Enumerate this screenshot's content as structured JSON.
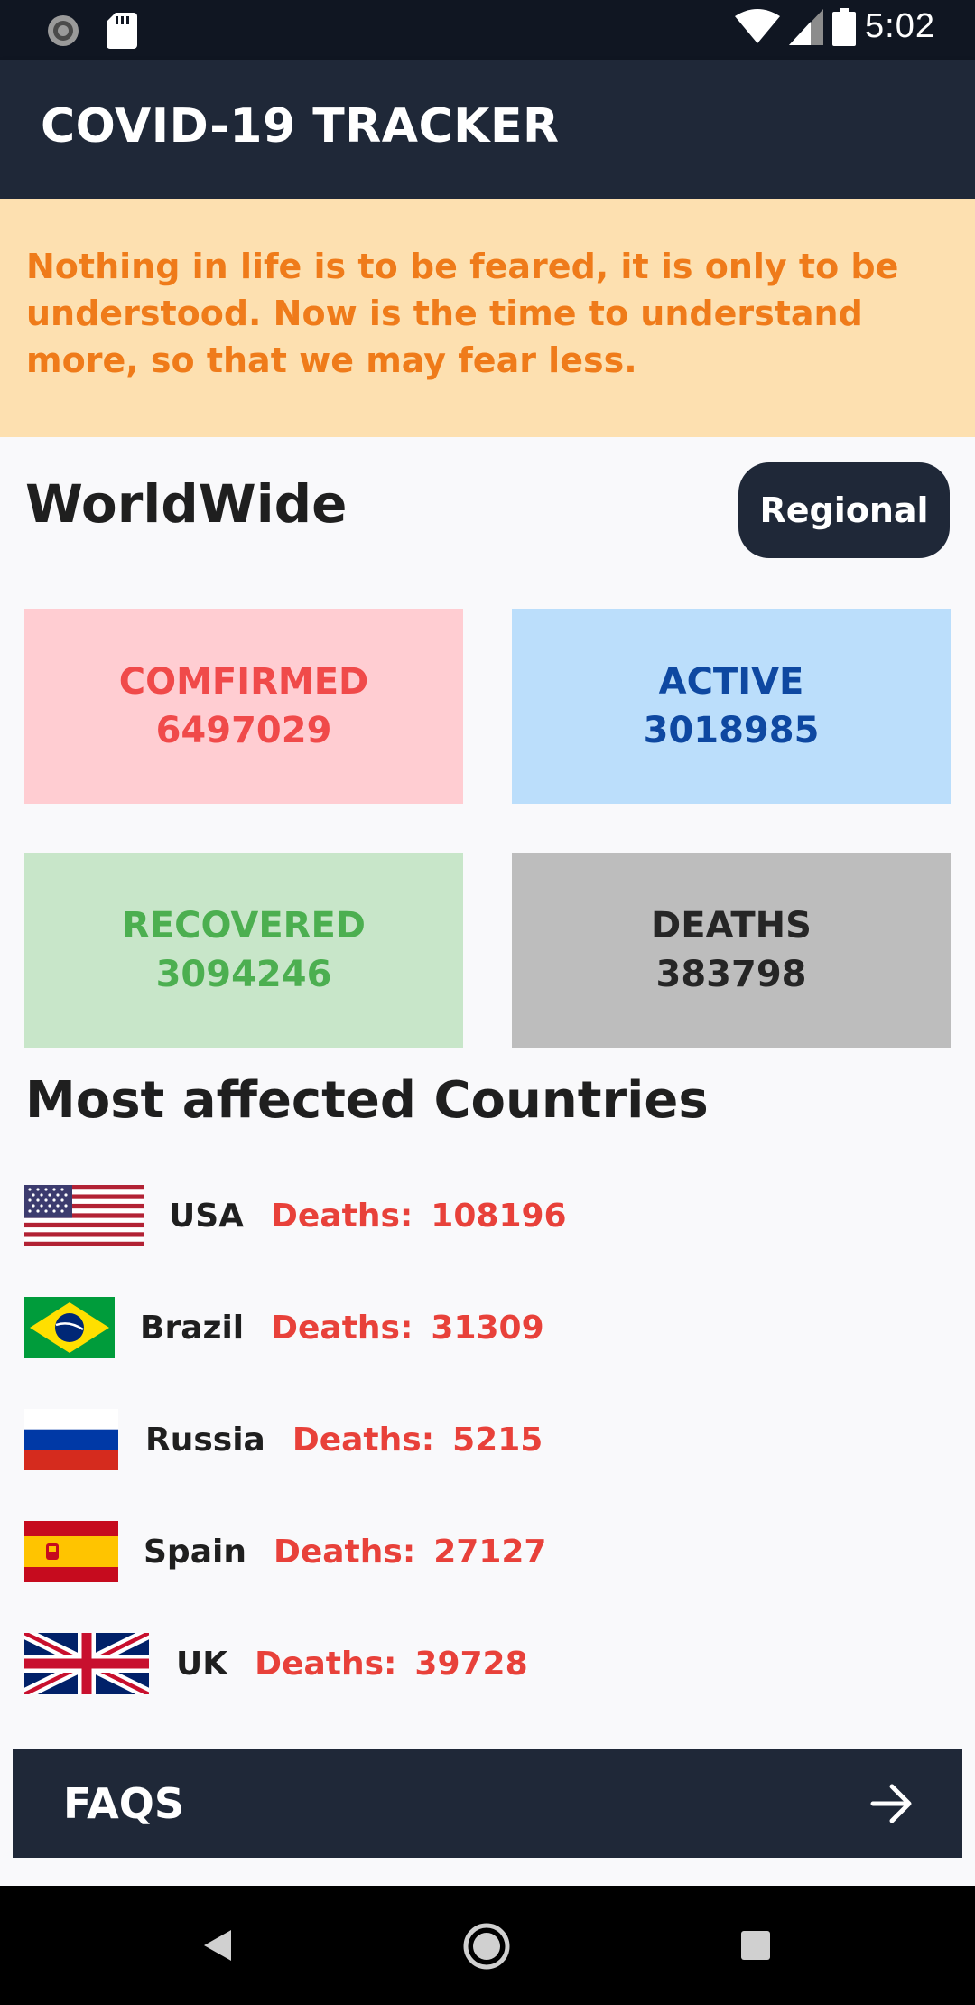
{
  "status_bar": {
    "time": "5:02",
    "icons": [
      "sync-icon",
      "sd-card-icon",
      "wifi-icon",
      "cell-signal-icon",
      "battery-icon"
    ]
  },
  "app_bar": {
    "title": "COVID-19 TRACKER"
  },
  "quote": {
    "text": "Nothing in life is to be feared, it is only to be understood. Now is the time to understand more, so that we may fear less."
  },
  "worldwide": {
    "title": "WorldWide",
    "regional_button": "Regional",
    "cards": {
      "confirmed": {
        "label": "COMFIRMED",
        "value": "6497029"
      },
      "active": {
        "label": "ACTIVE",
        "value": "3018985"
      },
      "recovered": {
        "label": "RECOVERED",
        "value": "3094246"
      },
      "deaths": {
        "label": "DEATHS",
        "value": "383798"
      }
    }
  },
  "countries_section": {
    "title": "Most affected Countries",
    "deaths_label": "Deaths:",
    "countries": [
      {
        "name": "USA",
        "deaths": "108196",
        "flag": "usa-flag-icon"
      },
      {
        "name": "Brazil",
        "deaths": "31309",
        "flag": "brazil-flag-icon"
      },
      {
        "name": "Russia",
        "deaths": "5215",
        "flag": "russia-flag-icon"
      },
      {
        "name": "Spain",
        "deaths": "27127",
        "flag": "spain-flag-icon"
      },
      {
        "name": "UK",
        "deaths": "39728",
        "flag": "uk-flag-icon"
      }
    ]
  },
  "faqs": {
    "label": "FAQS",
    "icon": "arrow-right-icon"
  },
  "nav_bar": {
    "icons": [
      "back-icon",
      "home-icon",
      "recents-icon"
    ]
  },
  "colors": {
    "app_bar": "#1f2838",
    "quote_background": "#fde0b0",
    "quote_text": "#ef7b1a",
    "confirmed": "#f04a4a",
    "active": "#0e48a1",
    "recovered": "#4caf50",
    "deaths": "#262626",
    "deaths_label": "#e8413a"
  }
}
